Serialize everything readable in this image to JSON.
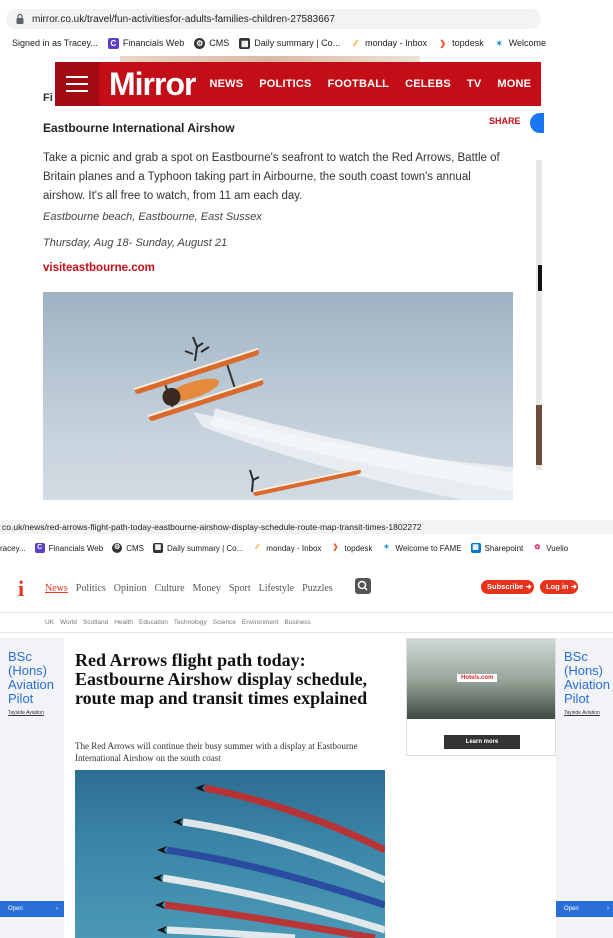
{
  "top": {
    "url": "mirror.co.uk/travel/fun-activitiesfor-adults-families-children-27583667",
    "bookmarks": [
      {
        "label": "Signed in as Tracey...",
        "icon": "none",
        "color": ""
      },
      {
        "label": "Financials Web",
        "icon": "C",
        "color": "#5b3fc4"
      },
      {
        "label": "CMS",
        "icon": "gear-icon",
        "color": "#333333"
      },
      {
        "label": "Daily summary | Co...",
        "icon": "calendar-icon",
        "color": "#333333"
      },
      {
        "label": "monday - Inbox",
        "icon": "monday-icon",
        "color": "#f5a623"
      },
      {
        "label": "topdesk",
        "icon": "chevron-icon",
        "color": "#e84e1b"
      },
      {
        "label": "Welcome",
        "icon": "star-icon",
        "color": "#1e88e5"
      }
    ],
    "nav": {
      "logo": "Mirror",
      "links": [
        "NEWS",
        "POLITICS",
        "FOOTBALL",
        "CELEBS",
        "TV",
        "MONE"
      ]
    },
    "partial_label": "Fi",
    "share_label": "SHARE",
    "heading": "Eastbourne International Airshow",
    "body": "Take a picnic and grab a spot on Eastbourne's seafront to watch the Red Arrows, Battle of Britain planes and a Typhoon taking part in Airbourne, the south coast town's annual airshow. It's all free to watch, from 11 am each day.",
    "location": "Eastbourne beach, Eastbourne, East Sussex",
    "dates": "Thursday, Aug 18- Sunday, August 21",
    "link": "visiteastbourne.com"
  },
  "bottom": {
    "url": "co.uk/news/red-arrows-flight-path-today-eastbourne-airshow-display-schedule-route-map-transit-times-1802272",
    "bookmarks": [
      {
        "label": "racey...",
        "icon": "none",
        "color": ""
      },
      {
        "label": "Financials Web",
        "icon": "C",
        "color": "#5b3fc4"
      },
      {
        "label": "CMS",
        "icon": "gear-icon",
        "color": "#333333"
      },
      {
        "label": "Daily summary | Co...",
        "icon": "calendar-icon",
        "color": "#333333"
      },
      {
        "label": "monday - Inbox",
        "icon": "monday-icon",
        "color": "#f5a623"
      },
      {
        "label": "topdesk",
        "icon": "chevron-icon",
        "color": "#e84e1b"
      },
      {
        "label": "Welcome to FAME",
        "icon": "star-icon",
        "color": "#1e88e5"
      },
      {
        "label": "Sharepoint",
        "icon": "grid-icon",
        "color": "#0078d4"
      },
      {
        "label": "Vuelio",
        "icon": "flower-icon",
        "color": "#e91e63"
      }
    ],
    "logo": "i",
    "nav_links": [
      "News",
      "Politics",
      "Opinion",
      "Culture",
      "Money",
      "Sport",
      "Lifestyle",
      "Puzzles"
    ],
    "subscribe": "Subscribe",
    "login": "Log in",
    "subnav": [
      "UK",
      "World",
      "Scotland",
      "Health",
      "Education",
      "Technology",
      "Science",
      "Environment",
      "Business"
    ],
    "side_ad": {
      "title": "BSc (Hons) Aviation Pilot",
      "sponsor": "Tayside Aviation",
      "cta": "Open"
    },
    "headline": "Red Arrows flight path today: Eastbourne Airshow display schedule, route map and transit times explained",
    "standfirst": "The Red Arrows will continue their busy summer with a display at Eastbourne International Airshow on the south coast",
    "ad": {
      "brand": "Hotels.com",
      "cta": "Learn more"
    }
  }
}
